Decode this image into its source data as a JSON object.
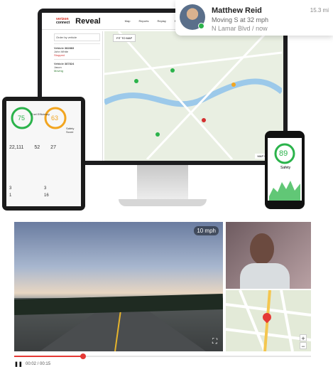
{
  "notification": {
    "name": "Matthew Reid",
    "status": "Moving S at 32 mph",
    "location": "N Lamar Blvd",
    "separator": "/",
    "time": "now",
    "distance": "15.3 mi"
  },
  "app": {
    "brand_top": "verizon",
    "brand_bottom": "connect",
    "title": "Reveal",
    "nav": [
      "Map",
      "Reports",
      "Replay",
      "Places",
      "Alerts"
    ],
    "filter": "Order by vehicle",
    "fit_button": "FIT TO MAP",
    "map_button": "MAP",
    "satellite_button": "SATELLITE"
  },
  "vehicles": [
    {
      "name": "Vehicle 382883",
      "driver": "John White",
      "state": "Stopped"
    },
    {
      "name": "Vehicle 387824",
      "driver": "Jason",
      "state": "Moving"
    }
  ],
  "tablet": {
    "score_a": "75",
    "score_b": "63",
    "label_a": "Fuel Efficiency",
    "label_b": "Safety Score",
    "stat1": "22,111",
    "stat2": "52",
    "stat3": "27",
    "legend": [
      "3",
      "1",
      "3",
      "16"
    ]
  },
  "phone": {
    "score": "89",
    "label": "Safety"
  },
  "video": {
    "speed": "10 mph",
    "time": "00:02 / 00:15"
  },
  "colors": {
    "accent": "#e53935",
    "green": "#2bb34b",
    "warning": "#f2a520"
  }
}
